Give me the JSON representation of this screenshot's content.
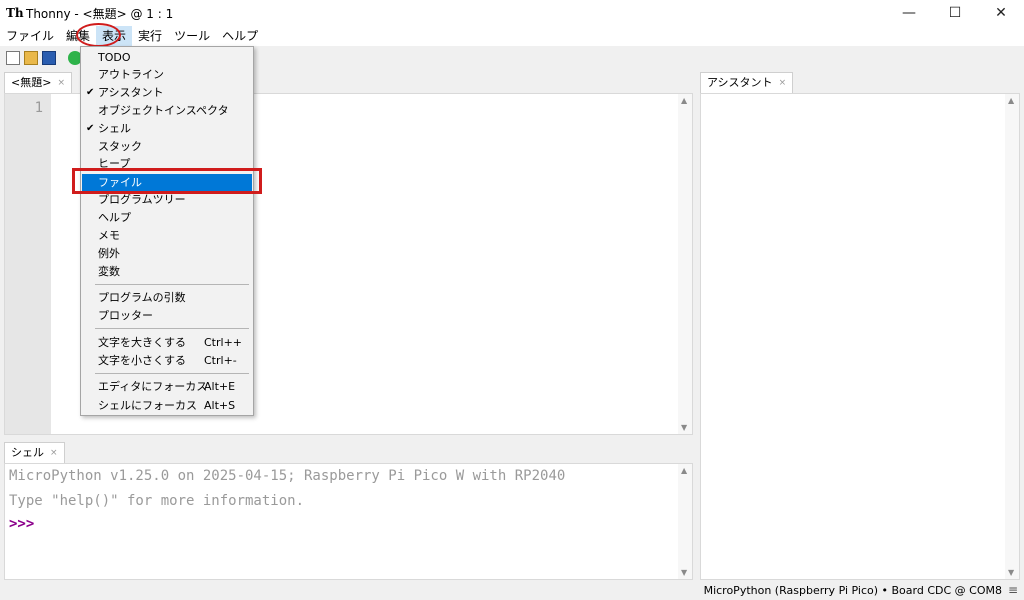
{
  "window": {
    "app_icon": "Th",
    "title": "Thonny  -  <無題>  @  1 : 1",
    "minimize_icon": "—",
    "maximize_icon": "☐",
    "close_icon": "✕"
  },
  "menubar": {
    "items": [
      "ファイル",
      "編集",
      "表示",
      "実行",
      "ツール",
      "ヘルプ"
    ]
  },
  "editor": {
    "tab_label": "<無題>",
    "tab_close": "×",
    "line_number": "1"
  },
  "assistant": {
    "tab_label": "アシスタント",
    "tab_close": "×"
  },
  "shell": {
    "tab_label": "シェル",
    "tab_close": "×",
    "line1": "MicroPython v1.25.0 on 2025-04-15; Raspberry Pi Pico W with RP2040",
    "line2": "Type \"help()\" for more information.",
    "prompt": ">>>"
  },
  "status": {
    "text": "MicroPython (Raspberry Pi Pico)  •  Board CDC @ COM8",
    "grip": "≡"
  },
  "view_menu": {
    "items": [
      {
        "label": "TODO",
        "checked": false
      },
      {
        "label": "アウトライン",
        "checked": false
      },
      {
        "label": "アシスタント",
        "checked": true
      },
      {
        "label": "オブジェクトインスペクタ",
        "checked": false
      },
      {
        "label": "シェル",
        "checked": true
      },
      {
        "label": "スタック",
        "checked": false
      },
      {
        "label": "ヒープ",
        "checked": false
      },
      {
        "label": "ファイル",
        "checked": false,
        "highlighted": true
      },
      {
        "label": "プログラムツリー",
        "checked": false
      },
      {
        "label": "ヘルプ",
        "checked": false
      },
      {
        "label": "メモ",
        "checked": false
      },
      {
        "label": "例外",
        "checked": false
      },
      {
        "label": "変数",
        "checked": false
      },
      {
        "label": "プログラムの引数",
        "checked": false
      },
      {
        "label": "プロッター",
        "checked": false
      },
      {
        "label": "文字を大きくする",
        "shortcut": "Ctrl++"
      },
      {
        "label": "文字を小さくする",
        "shortcut": "Ctrl+-"
      },
      {
        "label": "エディタにフォーカス",
        "shortcut": "Alt+E"
      },
      {
        "label": "シェルにフォーカス",
        "shortcut": "Alt+S"
      }
    ],
    "check_glyph": "✔"
  },
  "colors": {
    "highlight": "#0078d7",
    "annotation_red": "#d01c1c",
    "prompt": "#8b008b"
  }
}
